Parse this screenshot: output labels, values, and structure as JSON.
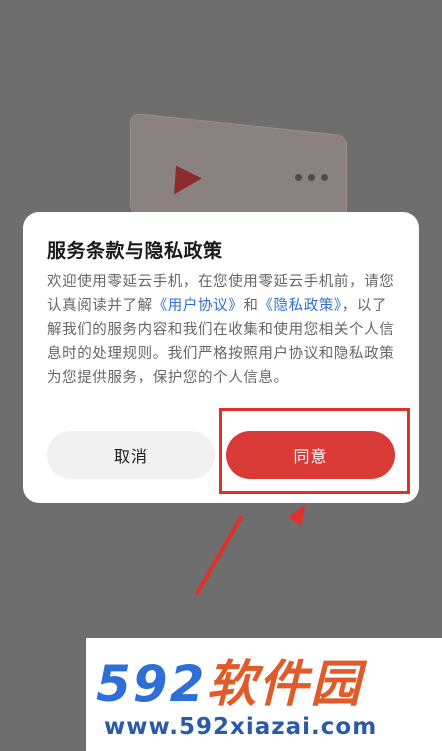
{
  "dialog": {
    "title": "服务条款与隐私政策",
    "body_part1": "欢迎使用零延云手机，在您使用零延云手机前，请您认真阅读并了解",
    "link_user_agreement": "《用户协议》",
    "and": "和",
    "link_privacy_policy": "《隐私政策》",
    "body_part2": "，以了解我们的服务内容和我们在收集和使用您相关个人信息时的处理规则。我们严格按照用户协议和隐私政策为您提供服务，保护您的个人信息。",
    "cancel_label": "取消",
    "agree_label": "同意"
  },
  "watermark": {
    "logo_number": "592",
    "logo_text": "软件园",
    "url": "www.592xiazai.com"
  },
  "colors": {
    "accent": "#d93a36",
    "link": "#2d6fd6",
    "overlay": "#6e6e6e"
  }
}
